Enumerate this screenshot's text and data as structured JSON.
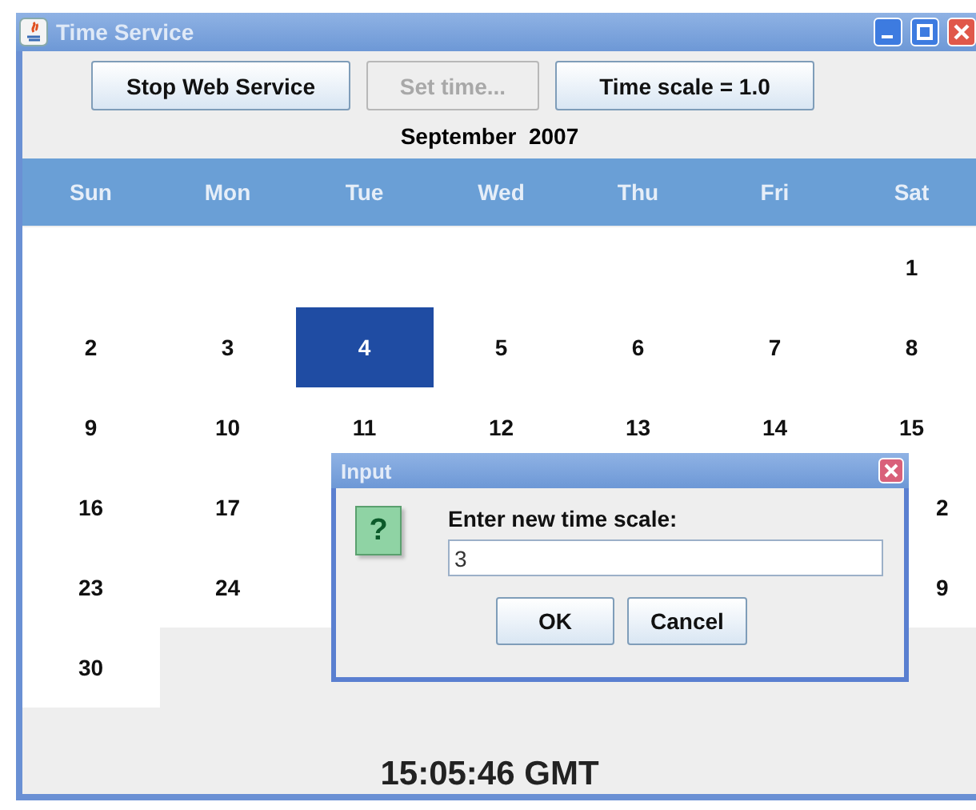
{
  "window": {
    "title": "Time Service"
  },
  "toolbar": [
    {
      "label": "Stop Web Service",
      "disabled": false
    },
    {
      "label": "Set time...",
      "disabled": true
    },
    {
      "label": "Time scale = 1.0",
      "disabled": false
    }
  ],
  "calendar": {
    "month": "September  2007",
    "weekdays": [
      "Sun",
      "Mon",
      "Tue",
      "Wed",
      "Thu",
      "Fri",
      "Sat"
    ],
    "weeks": [
      {
        "kind": "leading",
        "days": [
          {
            "day": "1",
            "selected": false,
            "kind": "full"
          }
        ]
      },
      {
        "kind": "full",
        "days": [
          {
            "day": "2",
            "selected": false,
            "kind": "full"
          },
          {
            "day": "3",
            "selected": false,
            "kind": "full"
          },
          {
            "day": "4",
            "selected": true,
            "kind": "full"
          },
          {
            "day": "5",
            "selected": false,
            "kind": "full"
          },
          {
            "day": "6",
            "selected": false,
            "kind": "full"
          },
          {
            "day": "7",
            "selected": false,
            "kind": "full"
          },
          {
            "day": "8",
            "selected": false,
            "kind": "full"
          }
        ]
      },
      {
        "kind": "full",
        "days": [
          {
            "day": "9",
            "selected": false,
            "kind": "full"
          },
          {
            "day": "10",
            "selected": false,
            "kind": "full"
          },
          {
            "day": "11",
            "selected": false,
            "kind": "full"
          },
          {
            "day": "12",
            "selected": false,
            "kind": "full"
          },
          {
            "day": "13",
            "selected": false,
            "kind": "full"
          },
          {
            "day": "14",
            "selected": false,
            "kind": "full"
          },
          {
            "day": "15",
            "selected": false,
            "kind": "full"
          }
        ]
      },
      {
        "kind": "full",
        "days": [
          {
            "day": "16",
            "selected": false,
            "kind": "full"
          },
          {
            "day": "17",
            "selected": false,
            "kind": "full"
          },
          {
            "day": "2",
            "selected": false,
            "kind": "clipped"
          }
        ]
      },
      {
        "kind": "full",
        "days": [
          {
            "day": "23",
            "selected": false,
            "kind": "full"
          },
          {
            "day": "24",
            "selected": false,
            "kind": "full"
          },
          {
            "day": "9",
            "selected": false,
            "kind": "clipped"
          }
        ]
      },
      {
        "kind": "trailing",
        "days": [
          {
            "day": "30",
            "selected": false,
            "kind": "full"
          }
        ]
      }
    ]
  },
  "clock": "15:05:46 GMT",
  "dialog": {
    "title": "Input",
    "icon": "?",
    "prompt": "Enter new time scale:",
    "value": "3",
    "buttons": [
      "OK",
      "Cancel"
    ]
  }
}
